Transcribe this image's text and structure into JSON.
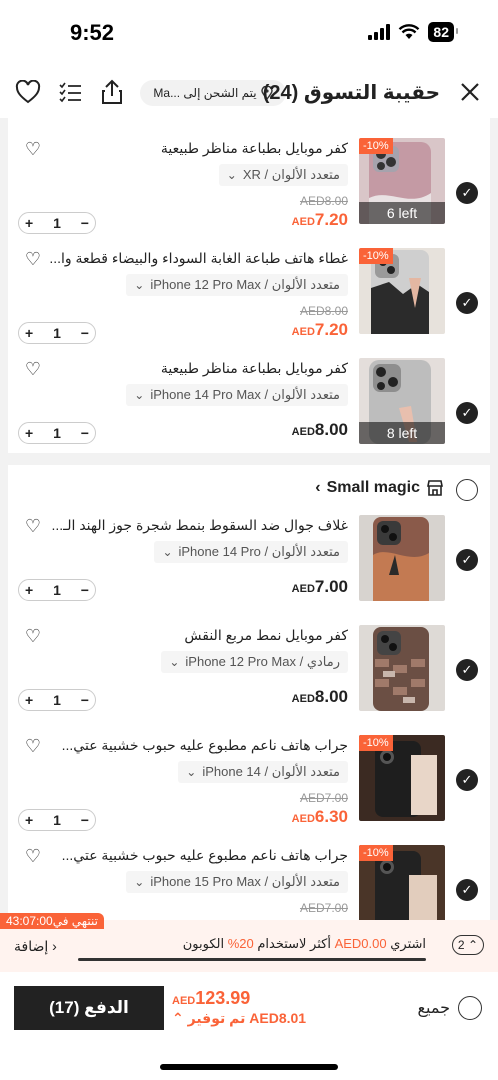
{
  "status": {
    "time": "9:52",
    "battery": "82"
  },
  "header": {
    "title": "حقيبة التسوق (24)",
    "ship_label": "يتم الشحن إلى ...Ma"
  },
  "store1_items": [
    {
      "name": "كفر موبايل بطباعة مناظر طبيعية",
      "variant": "متعدد الألوان / XR",
      "old_price": "AED8.00",
      "price_prefix": "AED",
      "price": "7.20",
      "discount": "-10%",
      "stock": "6 left",
      "qty": "1"
    },
    {
      "name": "غطاء هاتف طباعة الغابة السوداء والبيضاء قطعة وا...",
      "variant": "متعدد الألوان / iPhone 12 Pro Max",
      "old_price": "AED8.00",
      "price_prefix": "AED",
      "price": "7.20",
      "discount": "-10%",
      "qty": "1"
    },
    {
      "name": "كفر موبايل بطباعة مناظر طبيعية",
      "variant": "متعدد الألوان / iPhone 14 Pro Max",
      "price_prefix": "AED",
      "price": "8.00",
      "stock": "8 left",
      "qty": "1"
    }
  ],
  "store2": {
    "name": "Small magic"
  },
  "store2_items": [
    {
      "name": "غلاف جوال ضد السقوط بنمط شجرة جوز الهند الـ...",
      "variant": "متعدد الألوان / iPhone 14 Pro",
      "price_prefix": "AED",
      "price": "7.00",
      "qty": "1"
    },
    {
      "name": "كفر موبايل نمط مربع النقش",
      "variant": "رمادي / iPhone 12 Pro Max",
      "price_prefix": "AED",
      "price": "8.00",
      "qty": "1"
    },
    {
      "name": "جراب هاتف ناعم مطبوع عليه حبوب خشبية عتي...",
      "variant": "متعدد الألوان / iPhone 14",
      "old_price": "AED7.00",
      "price_prefix": "AED",
      "price": "6.30",
      "discount": "-10%",
      "qty": "1"
    },
    {
      "name": "جراب هاتف ناعم مطبوع عليه حبوب خشبية عتي...",
      "variant": "متعدد الألوان / iPhone 15 Pro Max",
      "old_price": "AED7.00",
      "discount": "-10%"
    }
  ],
  "promo": {
    "countdown": "تنتهي في43:07:00",
    "text_prefix": "اشتري ",
    "amount": "AED0.00",
    "text_mid": " أكثر لاستخدام ",
    "percent": "20%",
    "text_suffix": " الكوبون",
    "add_label": "إضافة",
    "badge": "2"
  },
  "footer": {
    "select_all": "جميع",
    "total_prefix": "AED",
    "total": "123.99",
    "saved": "تم توفير AED8.01",
    "pay_label": "الدفع (17)"
  },
  "colors": {
    "accent": "#fa6338",
    "dark": "#222222"
  }
}
